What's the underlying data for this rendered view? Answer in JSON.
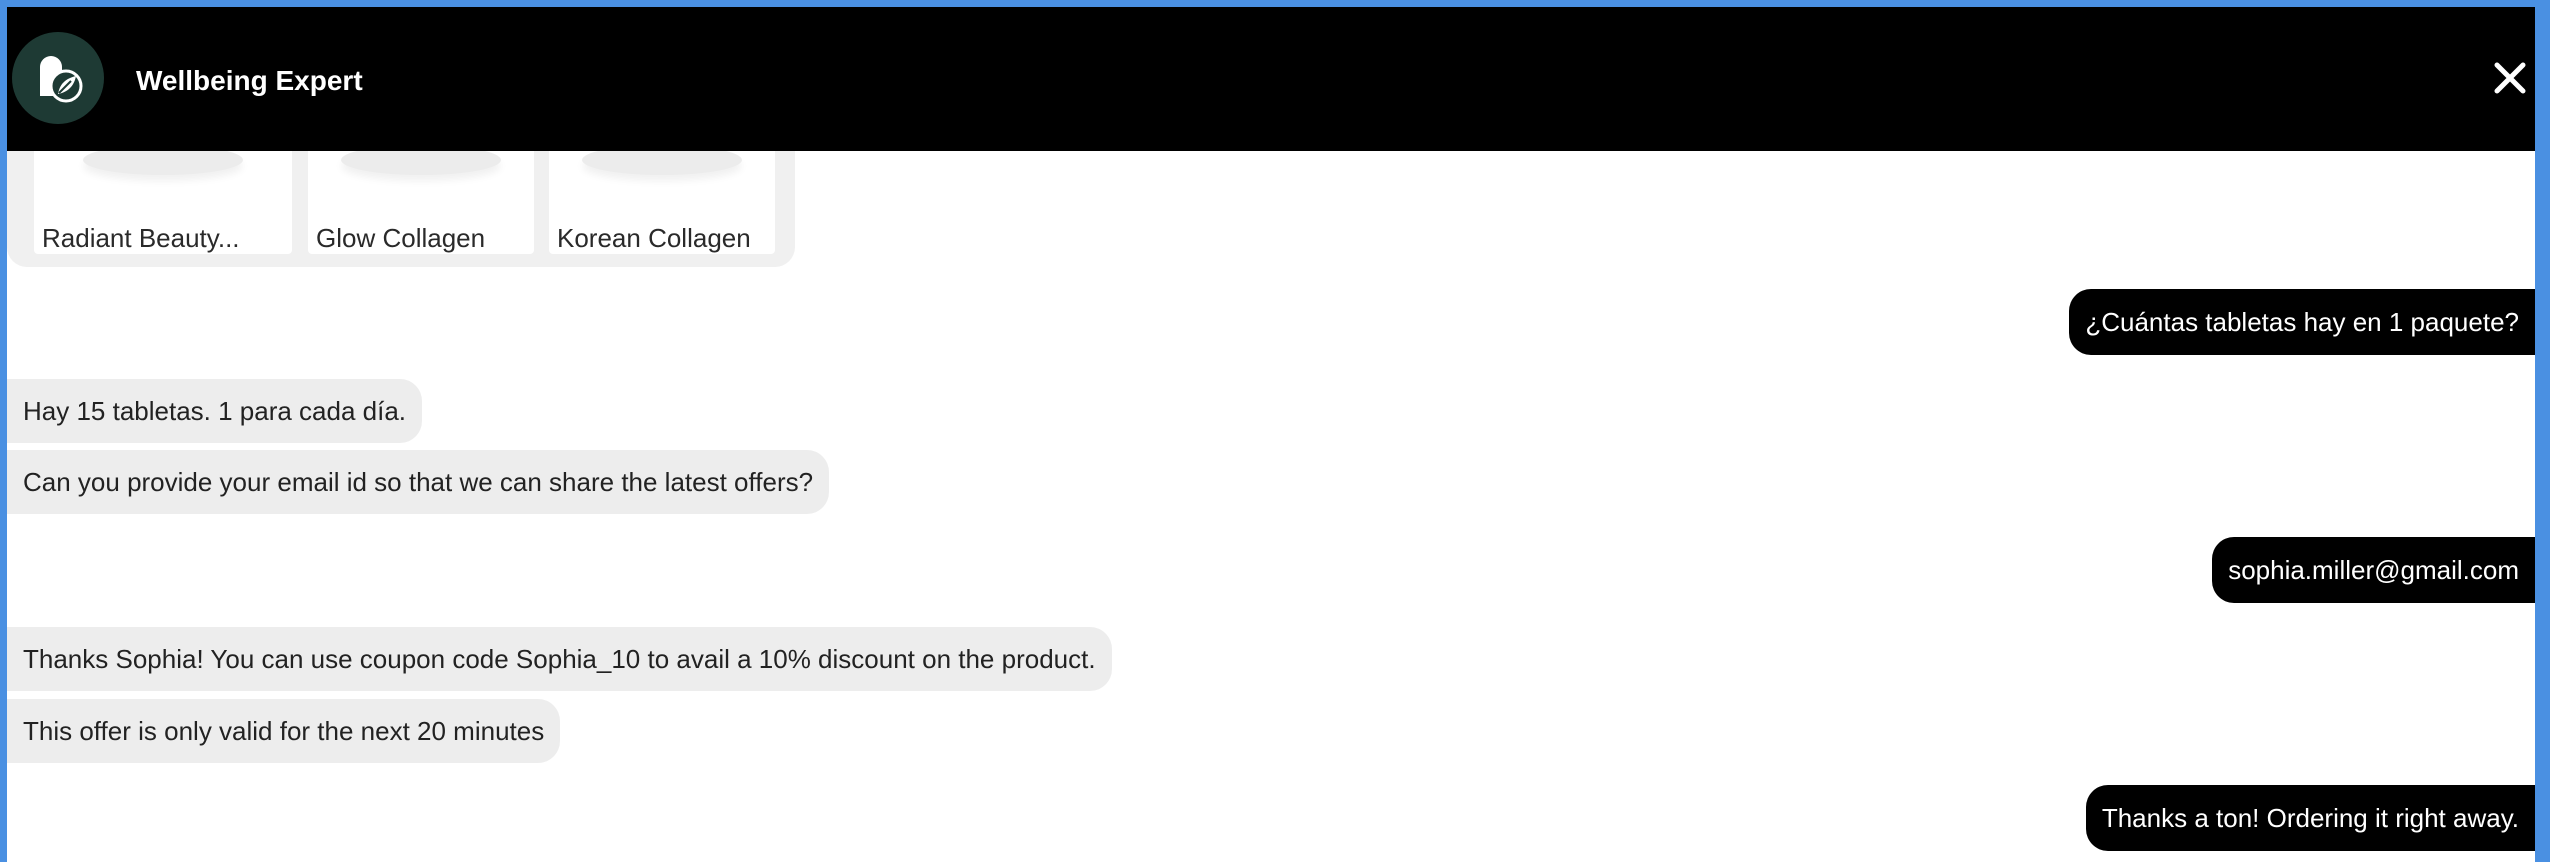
{
  "header": {
    "title": "Wellbeing Expert",
    "logo_icon": "leaf-capsule-icon",
    "close_icon": "close-icon"
  },
  "products": [
    {
      "label": "Radiant Beauty...",
      "tint": "#3aa37b"
    },
    {
      "label": "Glow Collagen",
      "tint": "#b5467a"
    },
    {
      "label": "Korean Collagen",
      "tint": "#c9a13a"
    }
  ],
  "messages": [
    {
      "from": "user",
      "text": "¿Cuántas tabletas hay en 1 paquete?"
    },
    {
      "from": "bot",
      "text": "Hay 15 tabletas. 1 para cada día."
    },
    {
      "from": "bot",
      "text": "Can you provide your email id so that we can share the latest offers?"
    },
    {
      "from": "user",
      "text": "sophia.miller@gmail.com"
    },
    {
      "from": "bot",
      "text": "Thanks Sophia! You can use coupon code Sophia_10 to avail a 10% discount on the product."
    },
    {
      "from": "bot",
      "text": "This offer is only valid for the next 20 minutes"
    },
    {
      "from": "user",
      "text": "Thanks a ton! Ordering it right away."
    }
  ],
  "colors": {
    "header_bg": "#000000",
    "user_bubble": "#000000",
    "bot_bubble": "#ededed",
    "window_border": "#4a90e2",
    "logo_bg": "#1e3a34"
  }
}
